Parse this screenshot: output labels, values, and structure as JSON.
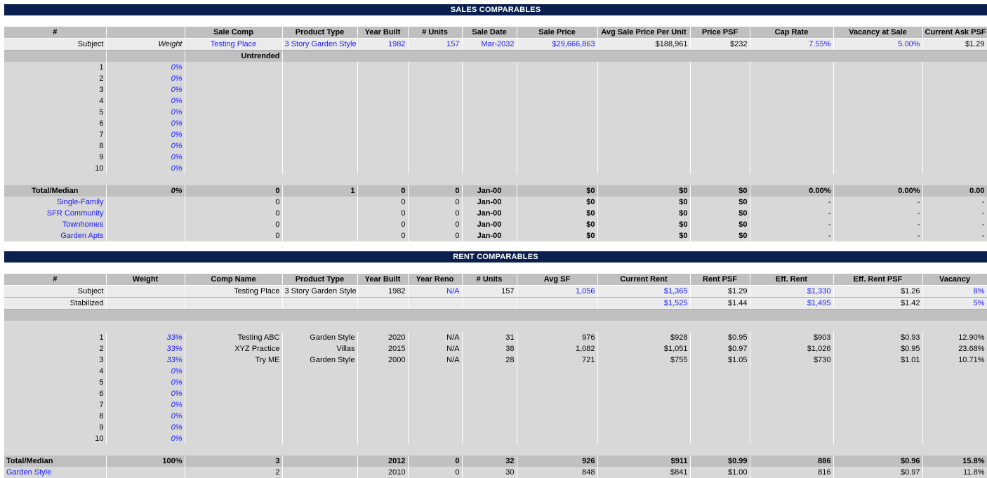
{
  "sales": {
    "title": "SALES COMPARABLES",
    "headers": [
      "#",
      "",
      "Sale Comp",
      "Product Type",
      "Year Built",
      "# Units",
      "Sale Date",
      "Sale Price",
      "Avg Sale Price Per Unit",
      "Price PSF",
      "Cap Rate",
      "Vacancy at Sale",
      "Current Ask PSF"
    ],
    "subject": {
      "label": "Subject",
      "weight": "Weight",
      "name": "Testing Place",
      "product_type": "3 Story Garden Style",
      "year_built": "1982",
      "units": "157",
      "sale_date": "Mar-2032",
      "sale_price": "$29,666,863",
      "avg_per_unit": "$188,961",
      "price_psf": "$232",
      "cap_rate": "7.55%",
      "vacancy": "5.00%",
      "ask_psf": "$1.29"
    },
    "untrended_label": "Untrended",
    "comps": [
      {
        "num": "1",
        "weight": "0%"
      },
      {
        "num": "2",
        "weight": "0%"
      },
      {
        "num": "3",
        "weight": "0%"
      },
      {
        "num": "4",
        "weight": "0%"
      },
      {
        "num": "5",
        "weight": "0%"
      },
      {
        "num": "6",
        "weight": "0%"
      },
      {
        "num": "7",
        "weight": "0%"
      },
      {
        "num": "8",
        "weight": "0%"
      },
      {
        "num": "9",
        "weight": "0%"
      },
      {
        "num": "10",
        "weight": "0%"
      }
    ],
    "total": {
      "label": "Total/Median",
      "weight": "0%",
      "name": "0",
      "product_type": "1",
      "year_built": "0",
      "units": "0",
      "sale_date": "Jan-00",
      "sale_price": "$0",
      "avg_per_unit": "$0",
      "price_psf": "$0",
      "cap_rate": "0.00%",
      "vacancy": "0.00%",
      "ask_psf": "0.00"
    },
    "categories": [
      {
        "label": "Single-Family",
        "name": "0",
        "year_built": "0",
        "units": "0",
        "sale_date": "Jan-00",
        "sale_price": "$0",
        "avg_per_unit": "$0",
        "price_psf": "$0",
        "cap_rate": "-",
        "vacancy": "-",
        "ask_psf": "-"
      },
      {
        "label": "SFR Community",
        "name": "0",
        "year_built": "0",
        "units": "0",
        "sale_date": "Jan-00",
        "sale_price": "$0",
        "avg_per_unit": "$0",
        "price_psf": "$0",
        "cap_rate": "-",
        "vacancy": "-",
        "ask_psf": "-"
      },
      {
        "label": "Townhomes",
        "name": "0",
        "year_built": "0",
        "units": "0",
        "sale_date": "Jan-00",
        "sale_price": "$0",
        "avg_per_unit": "$0",
        "price_psf": "$0",
        "cap_rate": "-",
        "vacancy": "-",
        "ask_psf": "-"
      },
      {
        "label": "Garden Apts",
        "name": "0",
        "year_built": "0",
        "units": "0",
        "sale_date": "Jan-00",
        "sale_price": "$0",
        "avg_per_unit": "$0",
        "price_psf": "$0",
        "cap_rate": "-",
        "vacancy": "-",
        "ask_psf": "-"
      }
    ]
  },
  "rent": {
    "title": "RENT COMPARABLES",
    "headers": [
      "#",
      "Weight",
      "Comp Name",
      "Product Type",
      "Year Built",
      "Year Reno",
      "# Units",
      "Avg SF",
      "Current Rent",
      "Rent PSF",
      "Eff. Rent",
      "Eff. Rent PSF",
      "Vacancy"
    ],
    "subject": {
      "label": "Subject",
      "name": "Testing Place",
      "product_type": "3 Story Garden Style",
      "year_built": "1982",
      "year_reno": "N/A",
      "units": "157",
      "avg_sf": "1,056",
      "current_rent": "$1,365",
      "rent_psf": "$1.29",
      "eff_rent": "$1,330",
      "eff_rent_psf": "$1.26",
      "vacancy": "8%"
    },
    "stabilized": {
      "label": "Stabilized",
      "current_rent": "$1,525",
      "rent_psf": "$1.44",
      "eff_rent": "$1,495",
      "eff_rent_psf": "$1.42",
      "vacancy": "5%"
    },
    "comps": [
      {
        "num": "1",
        "weight": "33%",
        "name": "Testing ABC",
        "product_type": "Garden Style",
        "year_built": "2020",
        "year_reno": "N/A",
        "units": "31",
        "avg_sf": "976",
        "current_rent": "$928",
        "rent_psf": "$0.95",
        "eff_rent": "$903",
        "eff_rent_psf": "$0.93",
        "vacancy": "12.90%"
      },
      {
        "num": "2",
        "weight": "33%",
        "name": "XYZ Practice",
        "product_type": "Villas",
        "year_built": "2015",
        "year_reno": "N/A",
        "units": "38",
        "avg_sf": "1,082",
        "current_rent": "$1,051",
        "rent_psf": "$0.97",
        "eff_rent": "$1,026",
        "eff_rent_psf": "$0.95",
        "vacancy": "23.68%"
      },
      {
        "num": "3",
        "weight": "33%",
        "name": "Try ME",
        "product_type": "Garden Style",
        "year_built": "2000",
        "year_reno": "N/A",
        "units": "28",
        "avg_sf": "721",
        "current_rent": "$755",
        "rent_psf": "$1.05",
        "eff_rent": "$730",
        "eff_rent_psf": "$1.01",
        "vacancy": "10.71%"
      },
      {
        "num": "4",
        "weight": "0%"
      },
      {
        "num": "5",
        "weight": "0%"
      },
      {
        "num": "6",
        "weight": "0%"
      },
      {
        "num": "7",
        "weight": "0%"
      },
      {
        "num": "8",
        "weight": "0%"
      },
      {
        "num": "9",
        "weight": "0%"
      },
      {
        "num": "10",
        "weight": "0%"
      }
    ],
    "total": {
      "label": "Total/Median",
      "weight": "100%",
      "name": "3",
      "year_built": "2012",
      "year_reno": "0",
      "units": "32",
      "avg_sf": "926",
      "current_rent": "$911",
      "rent_psf": "$0.99",
      "eff_rent": "886",
      "eff_rent_psf": "$0.96",
      "vacancy": "15.8%"
    },
    "category": {
      "label": "Garden Style",
      "name": "2",
      "year_built": "2010",
      "year_reno": "0",
      "units": "30",
      "avg_sf": "848",
      "current_rent": "$841",
      "rent_psf": "$1.00",
      "eff_rent": "816",
      "eff_rent_psf": "$0.97",
      "vacancy": "11.8%"
    }
  }
}
